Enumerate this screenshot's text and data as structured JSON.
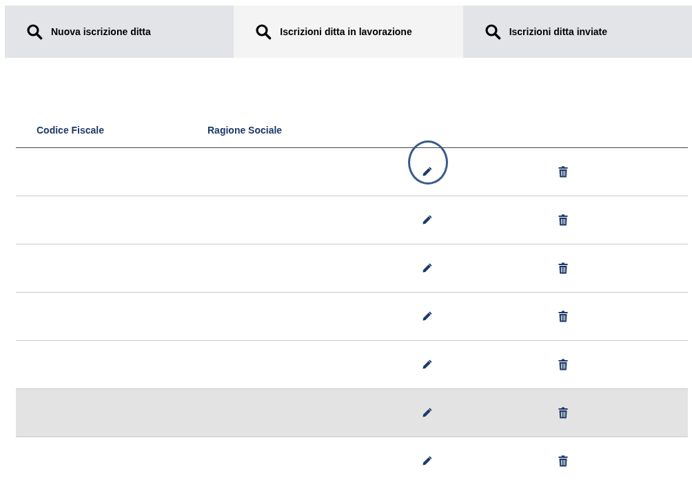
{
  "tabs": [
    {
      "label": "Nuova iscrizione ditta",
      "selected": false
    },
    {
      "label": "Iscrizioni ditta in lavorazione",
      "selected": true
    },
    {
      "label": "Iscrizioni ditta inviate",
      "selected": false
    }
  ],
  "table": {
    "columns": [
      "Codice Fiscale",
      "Ragione Sociale"
    ],
    "rows": [
      {
        "selected": false,
        "circled": true
      },
      {
        "selected": false,
        "circled": false
      },
      {
        "selected": false,
        "circled": false
      },
      {
        "selected": false,
        "circled": false
      },
      {
        "selected": false,
        "circled": false
      },
      {
        "selected": true,
        "circled": false
      },
      {
        "selected": false,
        "circled": false
      }
    ]
  }
}
